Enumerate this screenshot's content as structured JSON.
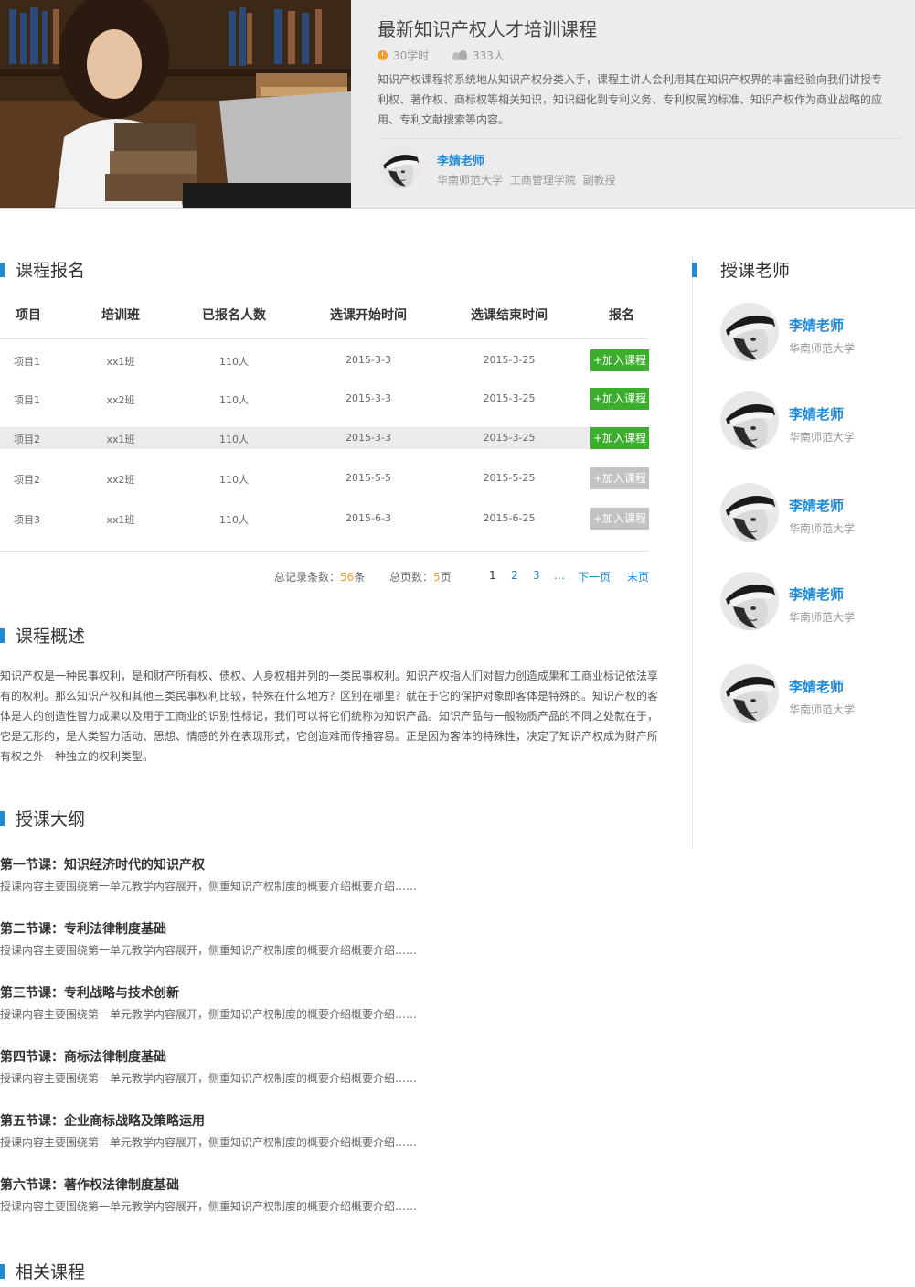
{
  "course": {
    "title": "最新知识产权人才培训课程",
    "hours": "30学时",
    "students": "333人",
    "description": "知识产权课程将系统地从知识产权分类入手，课程主讲人会利用其在知识产权界的丰富经验向我们讲授专利权、著作权、商标权等相关知识，知识细化到专利义务、专利权属的标准、知识产权作为商业战略的应用、专利文献搜索等内容。",
    "teacher_name": "李婧老师",
    "teacher_affiliation": "华南师范大学 工商管理学院 副教授"
  },
  "enroll": {
    "heading": "课程报名",
    "columns": [
      "项目",
      "培训班",
      "已报名人数",
      "选课开始时间",
      "选课结束时间",
      "报名"
    ],
    "rows": [
      {
        "project": "项目1",
        "class": "xx1班",
        "count": "110人",
        "start": "2015-3-3",
        "end": "2015-3-25",
        "button": "+加入课程",
        "active": true,
        "highlight": false
      },
      {
        "project": "项目1",
        "class": "xx2班",
        "count": "110人",
        "start": "2015-3-3",
        "end": "2015-3-25",
        "button": "+加入课程",
        "active": true,
        "highlight": false
      },
      {
        "project": "项目2",
        "class": "xx1班",
        "count": "110人",
        "start": "2015-3-3",
        "end": "2015-3-25",
        "button": "+加入课程",
        "active": true,
        "highlight": true
      },
      {
        "project": "项目2",
        "class": "xx2班",
        "count": "110人",
        "start": "2015-5-5",
        "end": "2015-5-25",
        "button": "+加入课程",
        "active": false,
        "highlight": false
      },
      {
        "project": "项目3",
        "class": "xx1班",
        "count": "110人",
        "start": "2015-6-3",
        "end": "2015-6-25",
        "button": "+加入课程",
        "active": false,
        "highlight": false
      }
    ],
    "pager": {
      "total_label": "总记录条数：",
      "total_value": "56",
      "total_unit": "条",
      "pages_label": "总页数：",
      "pages_value": "5",
      "pages_unit": "页",
      "pages": [
        "1",
        "2",
        "3",
        "…"
      ],
      "next": "下一页",
      "last": "末页"
    }
  },
  "overview": {
    "heading": "课程概述",
    "text": "知识产权是一种民事权利，是和财产所有权、债权、人身权相并列的一类民事权利。知识产权指人们对智力创造成果和工商业标记依法享有的权利。那么知识产权和其他三类民事权利比较，特殊在什么地方？区别在哪里？就在于它的保护对象即客体是特殊的。知识产权的客体是人的创造性智力成果以及用于工商业的识别性标记，我们可以将它们统称为知识产品。知识产品与一般物质产品的不同之处就在于，它是无形的，是人类智力活动、思想、情感的外在表现形式，它创造难而传播容易。正是因为客体的特殊性，决定了知识产权成为财产所有权之外一种独立的权利类型。"
  },
  "syllabus": {
    "heading": "授课大纲",
    "lessons": [
      {
        "title": "第一节课：知识经济时代的知识产权",
        "desc": "授课内容主要围绕第一单元教学内容展开，侧重知识产权制度的概要介绍概要介绍……"
      },
      {
        "title": "第二节课：专利法律制度基础",
        "desc": "授课内容主要围绕第一单元教学内容展开，侧重知识产权制度的概要介绍概要介绍……"
      },
      {
        "title": "第三节课：专利战略与技术创新",
        "desc": "授课内容主要围绕第一单元教学内容展开，侧重知识产权制度的概要介绍概要介绍……"
      },
      {
        "title": "第四节课：商标法律制度基础",
        "desc": "授课内容主要围绕第一单元教学内容展开，侧重知识产权制度的概要介绍概要介绍……"
      },
      {
        "title": "第五节课：企业商标战略及策略运用",
        "desc": "授课内容主要围绕第一单元教学内容展开，侧重知识产权制度的概要介绍概要介绍……"
      },
      {
        "title": "第六节课：著作权法律制度基础",
        "desc": "授课内容主要围绕第一单元教学内容展开，侧重知识产权制度的概要介绍概要介绍……"
      }
    ]
  },
  "related": {
    "heading": "相关课程"
  },
  "teachers": {
    "heading": "授课老师",
    "list": [
      {
        "name": "李婧老师",
        "school": "华南师范大学"
      },
      {
        "name": "李婧老师",
        "school": "华南师范大学"
      },
      {
        "name": "李婧老师",
        "school": "华南师范大学"
      },
      {
        "name": "李婧老师",
        "school": "华南师范大学"
      },
      {
        "name": "李婧老师",
        "school": "华南师范大学"
      }
    ]
  },
  "colors": {
    "accent": "#1e8ad6",
    "button_active": "#3dad2d",
    "button_disabled": "#c2c2c2",
    "highlight": "#f0a030"
  }
}
